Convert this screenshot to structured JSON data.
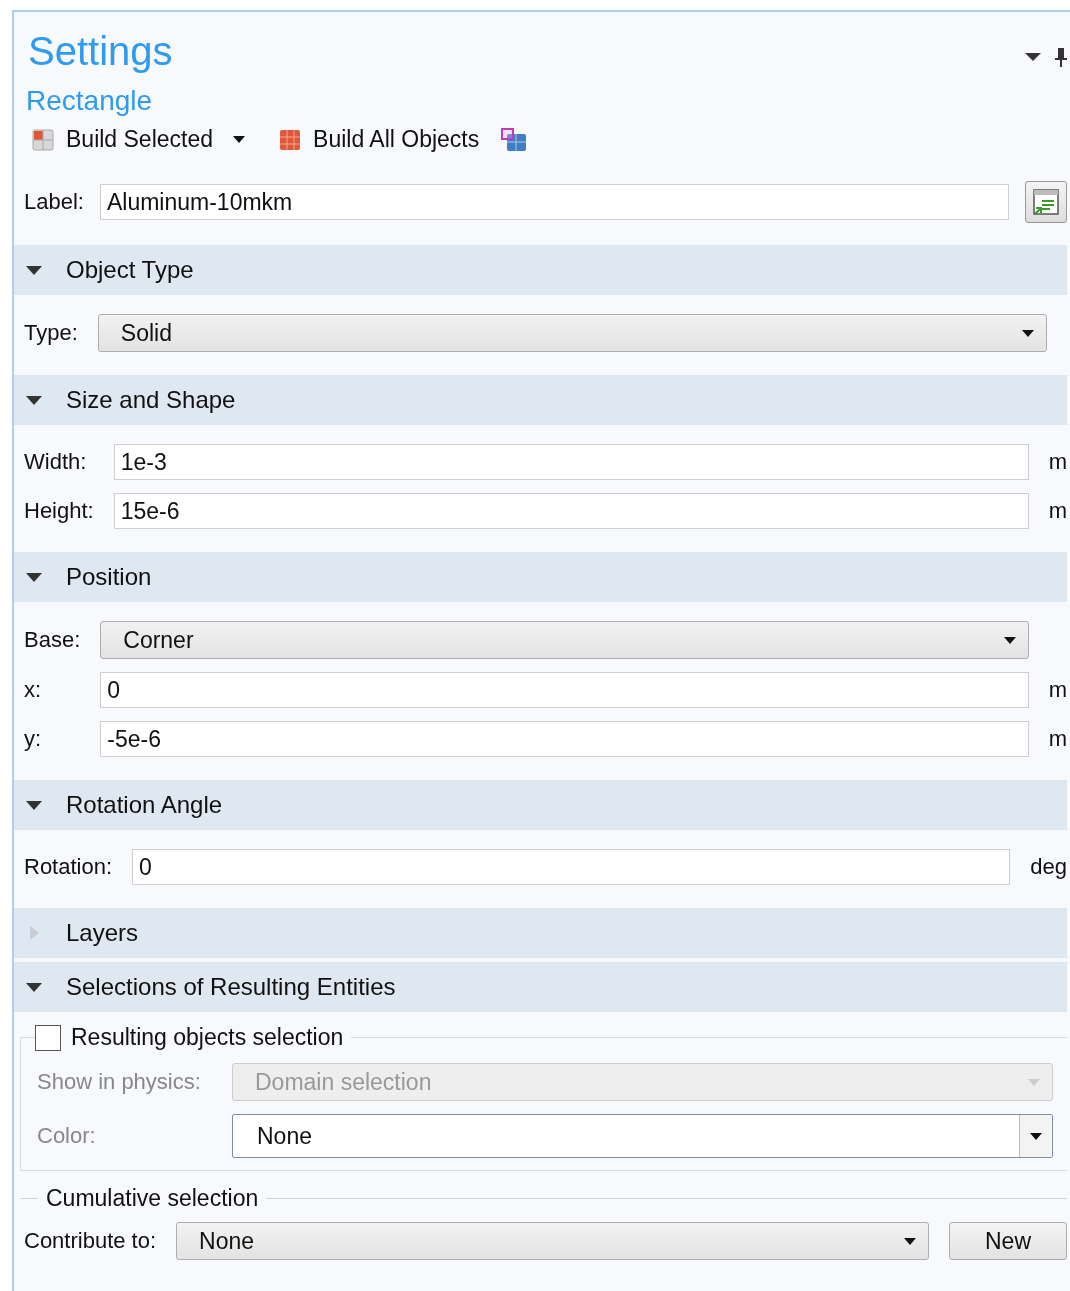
{
  "title": "Settings",
  "subtitle": "Rectangle",
  "toolbar": [
    {
      "kind": "build-selected",
      "label": "Build Selected",
      "dropdown": true
    },
    {
      "kind": "build-all",
      "label": "Build All Objects"
    },
    {
      "kind": "selection-cubes"
    }
  ],
  "label_field": {
    "label": "Label:",
    "value": "Aluminum-10mkm"
  },
  "sections": [
    {
      "title": "Object Type",
      "expanded": true,
      "rows": [
        {
          "kind": "select",
          "label": "Type:",
          "value": "Solid"
        }
      ]
    },
    {
      "title": "Size and Shape",
      "expanded": true,
      "rows": [
        {
          "kind": "input",
          "label": "Width:",
          "value": "1e-3",
          "unit": "m"
        },
        {
          "kind": "input",
          "label": "Height:",
          "value": "15e-6",
          "unit": "m"
        }
      ]
    },
    {
      "title": "Position",
      "expanded": true,
      "rows": [
        {
          "kind": "select",
          "label": "Base:",
          "value": "Corner"
        },
        {
          "kind": "input",
          "label": "x:",
          "value": "0",
          "unit": "m"
        },
        {
          "kind": "input",
          "label": "y:",
          "value": "-5e-6",
          "unit": "m"
        }
      ]
    },
    {
      "title": "Rotation Angle",
      "expanded": true,
      "rows": [
        {
          "kind": "input",
          "label": "Rotation:",
          "value": "0",
          "unit": "deg"
        }
      ]
    },
    {
      "title": "Layers",
      "expanded": false
    },
    {
      "title": "Selections of Resulting Entities",
      "expanded": true
    }
  ],
  "resulting_group": {
    "label": "Resulting objects selection",
    "checked": false,
    "rows": [
      {
        "kind": "select",
        "label": "Show in physics:",
        "value": "Domain selection",
        "disabled": true
      },
      {
        "kind": "combo",
        "label": "Color:",
        "value": "None",
        "disabled": false
      }
    ]
  },
  "cumulative_group": {
    "title": "Cumulative selection",
    "label": "Contribute to:",
    "value": "None",
    "button": "New"
  }
}
